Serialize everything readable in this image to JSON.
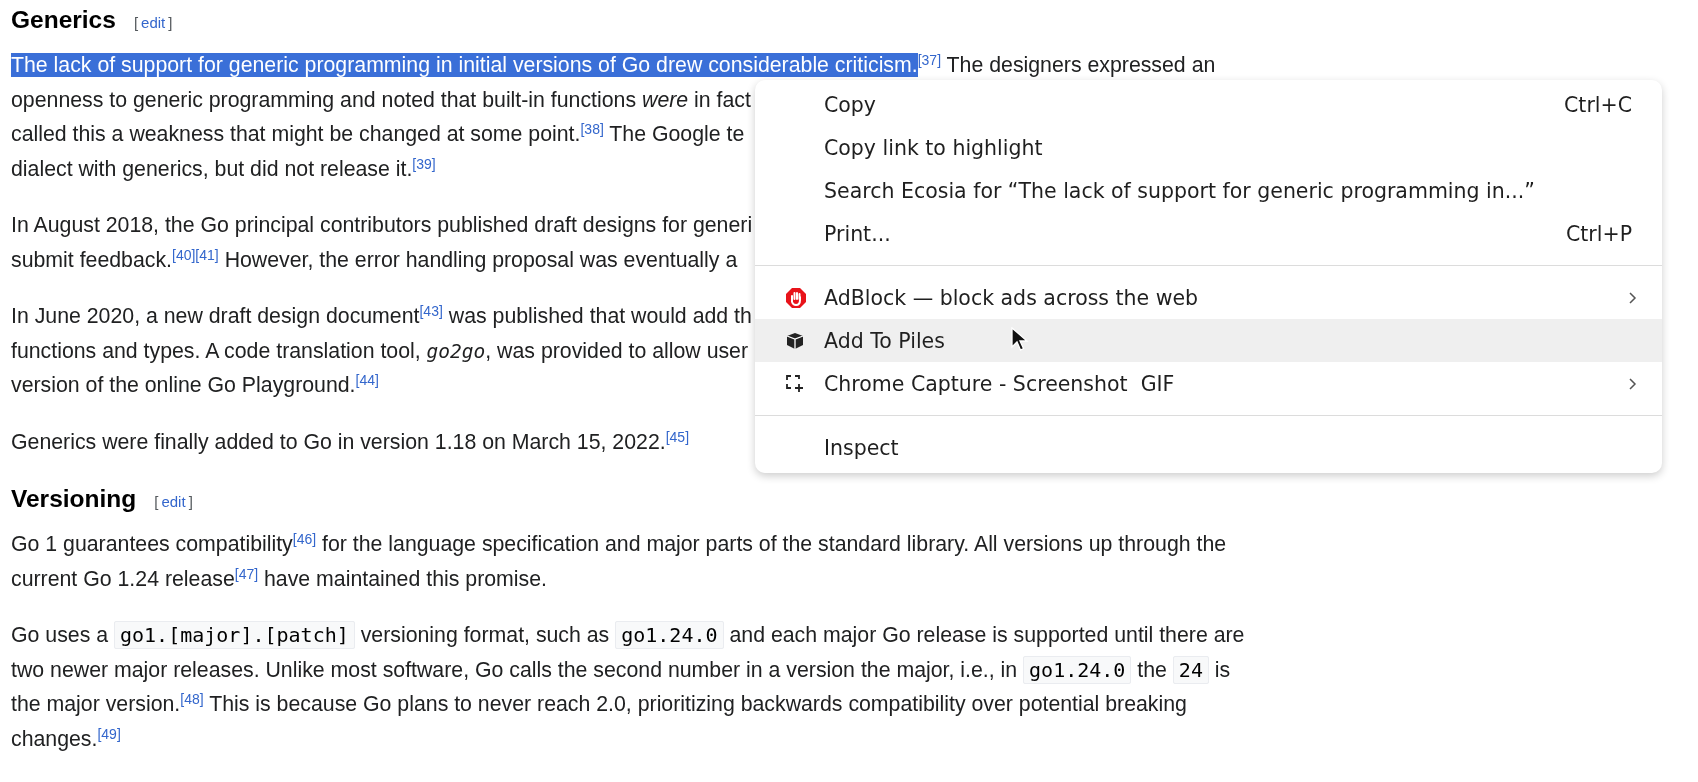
{
  "sections": [
    {
      "heading": "Generics",
      "edit_open": "[",
      "edit_link": "edit",
      "edit_close": "]",
      "paragraphs": [
        {
          "lines": [
            [
              {
                "kind": "selected",
                "text": "The lack of support for generic programming in initial versions of Go drew considerable criticism."
              },
              {
                "kind": "ref",
                "text": "[37]"
              },
              {
                "kind": "text",
                "text": " The designers expressed an"
              }
            ],
            [
              {
                "kind": "text",
                "text": "openness to generic programming and noted that built-in functions "
              },
              {
                "kind": "italic",
                "text": "were"
              },
              {
                "kind": "text",
                "text": " in fact"
              }
            ],
            [
              {
                "kind": "text",
                "text": "called this a weakness that might be changed at some point."
              },
              {
                "kind": "ref",
                "text": "[38]"
              },
              {
                "kind": "text",
                "text": " The Google te"
              }
            ],
            [
              {
                "kind": "text",
                "text": "dialect with generics, but did not release it."
              },
              {
                "kind": "ref",
                "text": "[39]"
              }
            ]
          ]
        },
        {
          "lines": [
            [
              {
                "kind": "text",
                "text": "In August 2018, the Go principal contributors published draft designs for generi"
              }
            ],
            [
              {
                "kind": "text",
                "text": "submit feedback."
              },
              {
                "kind": "ref",
                "text": "[40]"
              },
              {
                "kind": "ref",
                "text": "[41]"
              },
              {
                "kind": "text",
                "text": " However, the error handling proposal was eventually a"
              }
            ]
          ]
        },
        {
          "lines": [
            [
              {
                "kind": "text",
                "text": "In June 2020, a new draft design document"
              },
              {
                "kind": "ref",
                "text": "[43]"
              },
              {
                "kind": "text",
                "text": " was published that would add th"
              }
            ],
            [
              {
                "kind": "text",
                "text": "functions and types. A code translation tool, "
              },
              {
                "kind": "mono-italic",
                "text": "go2go"
              },
              {
                "kind": "text",
                "text": ", was provided to allow user"
              }
            ],
            [
              {
                "kind": "text",
                "text": "version of the online Go Playground."
              },
              {
                "kind": "ref",
                "text": "[44]"
              }
            ]
          ]
        },
        {
          "lines": [
            [
              {
                "kind": "text",
                "text": "Generics were finally added to Go in version 1.18 on March 15, 2022."
              },
              {
                "kind": "ref",
                "text": "[45]"
              }
            ]
          ]
        }
      ]
    },
    {
      "heading": "Versioning",
      "edit_open": "[",
      "edit_link": "edit",
      "edit_close": "]",
      "paragraphs": [
        {
          "lines": [
            [
              {
                "kind": "text",
                "text": "Go 1 guarantees compatibility"
              },
              {
                "kind": "ref",
                "text": "[46]"
              },
              {
                "kind": "text",
                "text": " for the language specification and major parts of the standard library. All versions up through the"
              }
            ],
            [
              {
                "kind": "text",
                "text": "current Go 1.24 release"
              },
              {
                "kind": "ref",
                "text": "[47]"
              },
              {
                "kind": "text",
                "text": " have maintained this promise."
              }
            ]
          ]
        },
        {
          "lines": [
            [
              {
                "kind": "text",
                "text": "Go uses a "
              },
              {
                "kind": "code",
                "text": "go1.[major].[patch]"
              },
              {
                "kind": "text",
                "text": " versioning format, such as "
              },
              {
                "kind": "code",
                "text": "go1.24.0"
              },
              {
                "kind": "text",
                "text": " and each major Go release is supported until there are"
              }
            ],
            [
              {
                "kind": "text",
                "text": "two newer major releases. Unlike most software, Go calls the second number in a version the major, i.e., in "
              },
              {
                "kind": "code",
                "text": "go1.24.0"
              },
              {
                "kind": "text",
                "text": " the "
              },
              {
                "kind": "code",
                "text": "24"
              },
              {
                "kind": "text",
                "text": " is"
              }
            ],
            [
              {
                "kind": "text",
                "text": "the major version."
              },
              {
                "kind": "ref",
                "text": "[48]"
              },
              {
                "kind": "text",
                "text": " This is because Go plans to never reach 2.0, prioritizing backwards compatibility over potential breaking"
              }
            ],
            [
              {
                "kind": "text",
                "text": "changes."
              },
              {
                "kind": "ref",
                "text": "[49]"
              }
            ]
          ]
        }
      ]
    }
  ],
  "context_menu": {
    "groups": [
      [
        {
          "label": "Copy",
          "shortcut": "Ctrl+C",
          "hovered": false,
          "submenu": false
        },
        {
          "label": "Copy link to highlight",
          "hovered": false,
          "submenu": false
        },
        {
          "label": "Search Ecosia for “The lack of support for generic programming in...”",
          "hovered": false,
          "submenu": false
        },
        {
          "label": "Print...",
          "shortcut": "Ctrl+P",
          "hovered": false,
          "submenu": false
        }
      ],
      [
        {
          "label": "AdBlock — block ads across the web",
          "kind": "adblock",
          "hovered": false,
          "submenu": true
        },
        {
          "label": "Add To Piles",
          "kind": "piles",
          "hovered": true,
          "submenu": false
        },
        {
          "label": "Chrome Capture - Screenshot  GIF",
          "kind": "capture",
          "hovered": false,
          "submenu": true
        }
      ],
      [
        {
          "label": "Inspect",
          "hovered": false,
          "submenu": false
        }
      ]
    ]
  }
}
